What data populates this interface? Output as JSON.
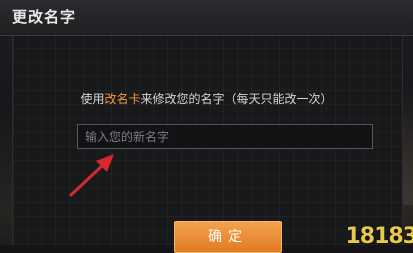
{
  "dialog": {
    "title": "更改名字",
    "instruction_prefix": "使用",
    "instruction_highlight": "改名卡",
    "instruction_suffix": "来修改您的名字（每天只能改一次）",
    "input_placeholder": "输入您的新名字",
    "input_value": "",
    "confirm_label": "确定"
  },
  "watermark": "18183",
  "colors": {
    "accent": "#f39a3a",
    "button": "#e98a2f",
    "arrow": "#d42a2a"
  }
}
